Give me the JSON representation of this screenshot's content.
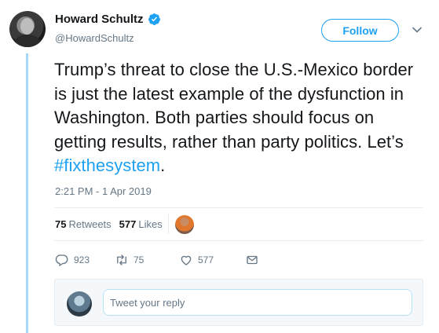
{
  "author": {
    "display_name": "Howard Schultz",
    "handle": "@HowardSchultz",
    "verified": true,
    "follow_label": "Follow"
  },
  "tweet": {
    "text_before": "Trump’s threat to close the U.S.-Mexico border is just the latest example of the dysfunction in Washington. Both parties should focus on getting results, rather than party politics. Let’s ",
    "hashtag": "#fixthesystem",
    "text_after": ".",
    "timestamp": "2:21 PM - 1 Apr 2019"
  },
  "stats": {
    "retweets_count": "75",
    "retweets_label": "Retweets",
    "likes_count": "577",
    "likes_label": "Likes"
  },
  "actions": {
    "reply_count": "923",
    "retweet_count": "75",
    "like_count": "577"
  },
  "reply": {
    "placeholder": "Tweet your reply"
  },
  "colors": {
    "accent": "#1da1f2",
    "thread_line": "#a4d9f7",
    "muted_text": "#657786"
  }
}
